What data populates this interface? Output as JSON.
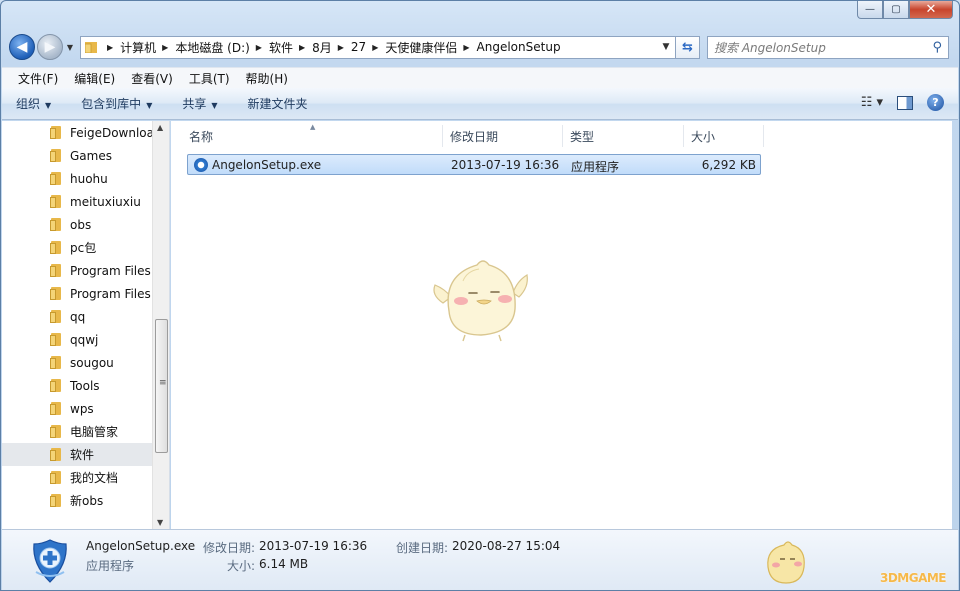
{
  "titlebar": {
    "minimize_glyph": "—",
    "maximize_glyph": "▢",
    "close_glyph": "✕"
  },
  "nav": {
    "back_glyph": "◀",
    "forward_glyph": "▶"
  },
  "address": {
    "crumbs": [
      "计算机",
      "本地磁盘 (D:)",
      "软件",
      "8月",
      "27",
      "天使健康伴侣",
      "AngelonSetup"
    ]
  },
  "search": {
    "placeholder": "搜索 AngelonSetup"
  },
  "menu": [
    "文件(F)",
    "编辑(E)",
    "查看(V)",
    "工具(T)",
    "帮助(H)"
  ],
  "commands": {
    "organize": "组织",
    "include_in_library": "包含到库中",
    "share": "共享",
    "new_folder": "新建文件夹"
  },
  "tree": [
    "FeigeDownloa",
    "Games",
    "huohu",
    "meituxiuxiu",
    "obs",
    "pc包",
    "Program Files",
    "Program Files",
    "qq",
    "qqwj",
    "sougou",
    "Tools",
    "wps",
    "电脑管家",
    "软件",
    "我的文档",
    "新obs"
  ],
  "tree_selected": "软件",
  "columns": {
    "name": "名称",
    "modified": "修改日期",
    "type": "类型",
    "size": "大小"
  },
  "files": [
    {
      "name": "AngelonSetup.exe",
      "modified": "2013-07-19 16:36",
      "type": "应用程序",
      "size": "6,292 KB"
    }
  ],
  "details": {
    "filename": "AngelonSetup.exe",
    "type": "应用程序",
    "modified_label": "修改日期:",
    "modified_value": "2013-07-19 16:36",
    "created_label": "创建日期:",
    "created_value": "2020-08-27 15:04",
    "size_label": "大小:",
    "size_value": "6.14 MB"
  },
  "watermark": "3DMGAME",
  "colors": {
    "accent": "#1a4f9f",
    "selection": "#c1dcfa",
    "watermark": "#f6b94a"
  }
}
